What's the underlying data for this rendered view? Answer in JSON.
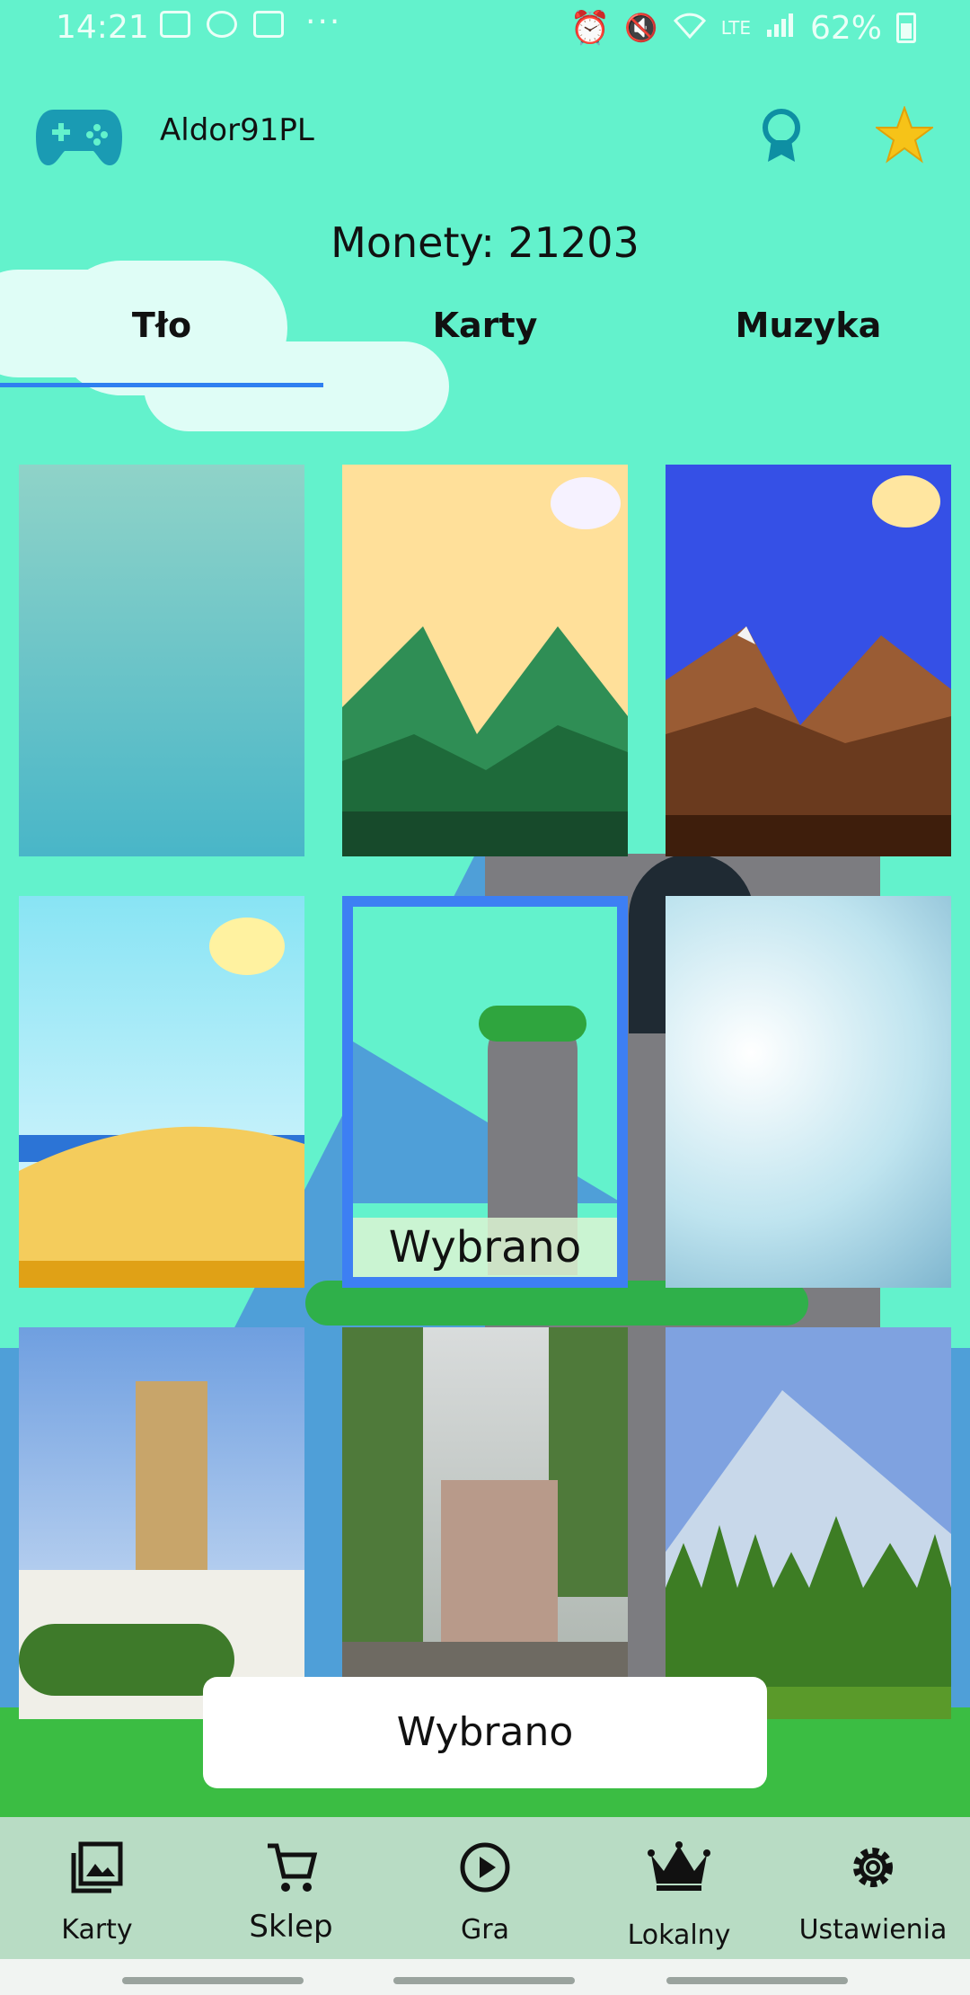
{
  "status": {
    "time": "14:21",
    "dots": "···",
    "network": "LTE",
    "battery": "62%"
  },
  "header": {
    "username": "Aldor91PL",
    "coins": "Monety: 21203"
  },
  "tabs": [
    {
      "label": "Tło",
      "active": true
    },
    {
      "label": "Karty"
    },
    {
      "label": "Muzyka"
    }
  ],
  "grid": {
    "selected_caption": "Wybrano",
    "tiles": [
      {
        "name": "teal-watercolor"
      },
      {
        "name": "green-mountains-sunset"
      },
      {
        "name": "brown-mountains-blue-sky"
      },
      {
        "name": "desert-dunes"
      },
      {
        "name": "ruined-tower",
        "selected": true
      },
      {
        "name": "clouds"
      },
      {
        "name": "church-tower-town"
      },
      {
        "name": "castle-bridge"
      },
      {
        "name": "forest-mountain"
      }
    ]
  },
  "action": {
    "select_label": "Wybrano"
  },
  "nav": [
    {
      "label": "Karty",
      "icon": "image-gallery-icon"
    },
    {
      "label": "Sklep",
      "icon": "shopping-cart-icon"
    },
    {
      "label": "Gra",
      "icon": "play-circle-icon"
    },
    {
      "label": "Lokalny",
      "icon": "crown-icon"
    },
    {
      "label": "Ustawienia",
      "icon": "gear-icon"
    }
  ],
  "colors": {
    "background": "#63f2cc",
    "accent": "#2f7ff0",
    "nav": "#b8dcc4"
  }
}
